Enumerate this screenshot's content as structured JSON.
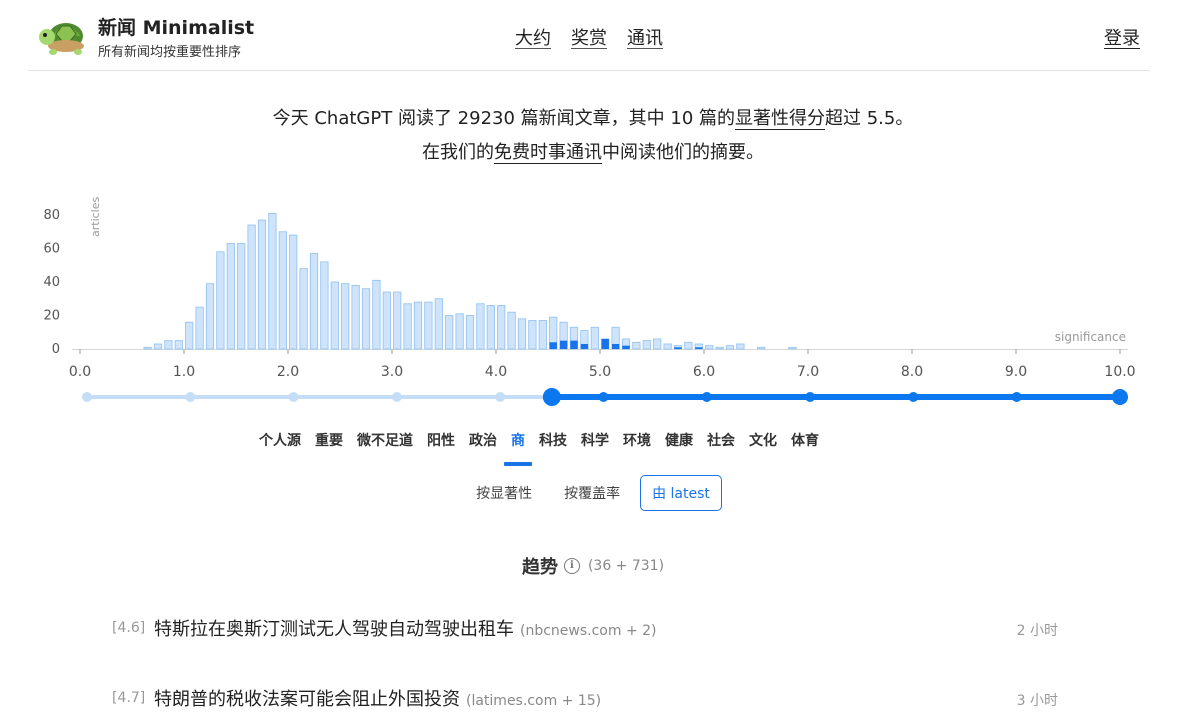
{
  "header": {
    "title": "新闻 Minimalist",
    "subtitle": "所有新闻均按重要性排序",
    "nav": [
      "大约",
      "奖赏",
      "通讯"
    ],
    "login": "登录",
    "logo_icon": "turtle-logo-icon"
  },
  "summary": {
    "part1": "今天 ChatGPT 阅读了 29230 篇新闻文章，其中 10 篇的",
    "link1": "显著性得分",
    "part2": "超过 5.5。",
    "part3": "在我们的",
    "link2": "免费时事通讯",
    "part4": "中阅读他们的摘要。"
  },
  "chart_data": {
    "type": "bar",
    "ylabel": "articles",
    "xlabel": "significance",
    "xlim": [
      0,
      10
    ],
    "ylim": [
      0,
      80
    ],
    "yticks": [
      0,
      20,
      40,
      60,
      80
    ],
    "xticks": [
      "0.0",
      "1.0",
      "2.0",
      "3.0",
      "4.0",
      "5.0",
      "6.0",
      "7.0",
      "8.0",
      "9.0",
      "10.0"
    ],
    "bin_width": 0.1,
    "bin_starts": [
      0.6,
      0.7,
      0.8,
      0.9,
      1.0,
      1.1,
      1.2,
      1.3,
      1.4,
      1.5,
      1.6,
      1.7,
      1.8,
      1.9,
      2.0,
      2.1,
      2.2,
      2.3,
      2.4,
      2.5,
      2.6,
      2.7,
      2.8,
      2.9,
      3.0,
      3.1,
      3.2,
      3.3,
      3.4,
      3.5,
      3.6,
      3.7,
      3.8,
      3.9,
      4.0,
      4.1,
      4.2,
      4.3,
      4.4,
      4.5,
      4.6,
      4.7,
      4.8,
      4.9,
      5.0,
      5.1,
      5.2,
      5.3,
      5.4,
      5.5,
      5.6,
      5.7,
      5.8,
      5.9,
      6.0,
      6.1,
      6.2,
      6.3,
      6.5,
      6.8
    ],
    "series": [
      {
        "values": [
          1,
          3,
          5,
          5,
          16,
          25,
          39,
          58,
          63,
          63,
          74,
          77,
          81,
          70,
          68,
          48,
          57,
          52,
          40,
          39,
          38,
          36,
          41,
          34,
          34,
          27,
          28,
          28,
          30,
          20,
          21,
          20,
          27,
          26,
          26,
          22,
          18,
          17,
          17,
          19,
          16,
          13,
          11,
          13,
          6,
          13,
          6,
          4,
          5,
          6,
          3,
          2,
          4,
          3,
          2,
          1,
          2,
          3,
          1,
          1
        ]
      },
      {
        "values": [
          0,
          0,
          0,
          0,
          0,
          0,
          0,
          0,
          0,
          0,
          0,
          0,
          0,
          0,
          0,
          0,
          0,
          0,
          0,
          0,
          0,
          0,
          0,
          0,
          0,
          0,
          0,
          0,
          0,
          0,
          0,
          0,
          0,
          0,
          0,
          0,
          0,
          0,
          0,
          4,
          5,
          5,
          3,
          0,
          6,
          3,
          2,
          0,
          0,
          0,
          0,
          1,
          0,
          1,
          0,
          0,
          0,
          0,
          0,
          0
        ]
      }
    ],
    "colors": {
      "light_fill": "#cfe4fb",
      "light_stroke": "#8ec0f2",
      "dark_fill": "#1a73e8"
    },
    "grid": false
  },
  "slider": {
    "ticks": [
      0,
      1,
      2,
      3,
      4,
      5,
      6,
      7,
      8,
      9,
      10
    ],
    "value": 4.5,
    "max": 10,
    "active_color": "#0b78f0",
    "inactive_color": "#c5def8"
  },
  "categories": {
    "items": [
      "个人源",
      "重要",
      "微不足道",
      "阳性",
      "政治",
      "商",
      "科技",
      "科学",
      "环境",
      "健康",
      "社会",
      "文化",
      "体育"
    ],
    "active": 5
  },
  "sorts": {
    "items": [
      "按显著性",
      "按覆盖率",
      "由 latest"
    ],
    "active": 2
  },
  "trending": {
    "title": "趋势",
    "counts": "(36 + 731)",
    "info_icon": "info-icon"
  },
  "news": [
    {
      "score": "[4.6]",
      "title": "特斯拉在奥斯汀测试无人驾驶自动驾驶出租车",
      "source": "(nbcnews.com + 2)",
      "time": "2 小时"
    },
    {
      "score": "[4.7]",
      "title": "特朗普的税收法案可能会阻止外国投资",
      "source": "(latimes.com + 15)",
      "time": "3 小时"
    }
  ]
}
